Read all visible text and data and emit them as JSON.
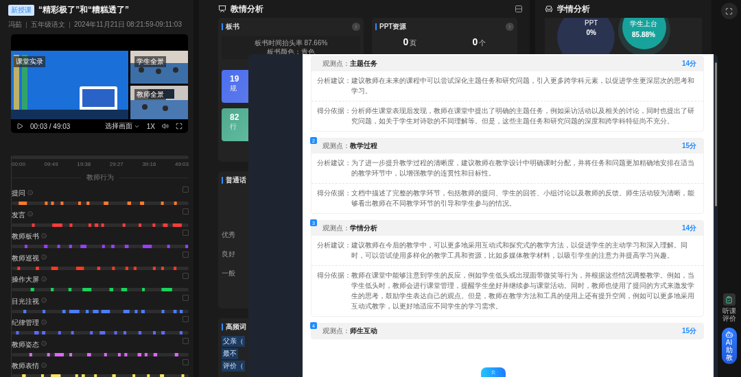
{
  "lesson": {
    "badge": "新授课",
    "title": "“精彩极了”和“糟糕透了”",
    "meta": [
      "冯茹",
      "五年级语文",
      "2024年11月21日 08:21:59-09:11:03"
    ]
  },
  "video": {
    "views": [
      "课堂实录",
      "学生全景",
      "教师全景"
    ],
    "time": "00:03 / 49:03",
    "view_select": "选择画面",
    "speed": "1X"
  },
  "timeline": {
    "ticks": [
      "00:00",
      "09:49",
      "19:38",
      "29:27",
      "39:16",
      "49:03"
    ],
    "section_title": "教师行为"
  },
  "behaviors": [
    {
      "label": "提问",
      "color": "#ff7a2e",
      "checked": false
    },
    {
      "label": "发言",
      "color": "#ff3b3b",
      "checked": false
    },
    {
      "label": "教师板书",
      "color": "#9b3cff",
      "checked": false
    },
    {
      "label": "教师巡视",
      "color": "#ff3a1f",
      "checked": false
    },
    {
      "label": "操作大屏",
      "color": "#19d35a",
      "checked": false
    },
    {
      "label": "目光注视",
      "color": "#4d7cff",
      "checked": false
    },
    {
      "label": "纪律管理",
      "color": "#5b6cff",
      "checked": false
    },
    {
      "label": "教师姿态",
      "color": "#e066ff",
      "checked": false
    },
    {
      "label": "教师表情",
      "color": "#f5e16a",
      "checked": false
    }
  ],
  "teaching": {
    "title": "教情分析",
    "board": {
      "title": "板书",
      "lines": [
        "板书时间抬头率 87.66%",
        "板书颜色：青色"
      ],
      "tiles": [
        {
          "value": "19",
          "label": "规"
        },
        {
          "value": "82",
          "label": "行"
        }
      ]
    },
    "ppt": {
      "title": "PPT资源",
      "stats": [
        {
          "value": "0",
          "unit": "页"
        },
        {
          "value": "0",
          "unit": "个"
        }
      ]
    },
    "mandarin": {
      "title": "普通话",
      "levels": [
        "优秀",
        "良好",
        "一般"
      ]
    },
    "words": {
      "title": "高频词",
      "items": [
        "父亲（",
        "最不",
        "评价（"
      ]
    }
  },
  "learning": {
    "title": "学情分析",
    "stats": [
      {
        "label": "PPT",
        "value": "0%"
      },
      {
        "label": "学生上台",
        "value": "85.88%"
      }
    ]
  },
  "side": {
    "evaluate": "听课评价",
    "ai": "AI助教"
  },
  "report": {
    "sections": [
      {
        "prefix": "观测点：",
        "title": "主题任务",
        "score": "14分",
        "advice_label": "分析建议：",
        "advice": "建议教师在未来的课程中可以尝试深化主题任务和研究问题，引入更多跨学科元素，以促进学生更深层次的思考和学习。",
        "basis_label": "得分依据：",
        "basis": "分析师生课堂表现后发现，教师在课堂中提出了明确的主题任务，例如采访活动以及相关的讨论，同时也提出了研究问题，如关于学生对诗歌的不同理解等。但是，这些主题任务和研究问题的深度和跨学科特征尚不充分。"
      },
      {
        "number": "2",
        "prefix": "观测点：",
        "title": "教学过程",
        "score": "15分",
        "advice_label": "分析建议：",
        "advice": "为了进一步提升教学过程的清晰度，建议教师在教学设计中明确课时分配，并将任务和问题更加精确地安排在适当的教学环节中，以增强教学的连贯性和目标性。",
        "basis_label": "得分依据：",
        "basis": "文档中描述了完整的教学环节，包括教师的提问、学生的回答、小组讨论以及教师的反馈。师生活动较为清晰，能够看出教师在不同教学环节的引导和学生参与的情况。"
      },
      {
        "number": "3",
        "prefix": "观测点：",
        "title": "学情分析",
        "score": "14分",
        "advice_label": "分析建议：",
        "advice": "建议教师在今后的教学中，可以更多地采用互动式和探究式的教学方法，以促进学生的主动学习和深入理解。同时，可以尝试使用多样化的教学工具和资源，比如多媒体教学材料，以吸引学生的注意力并提高学习兴趣。",
        "basis_label": "得分依据：",
        "basis": "教师在课堂中能够注意到学生的反应，例如学生低头或出现面带微笑等行为，并根据这些情况调整教学。例如，当学生低头时，教师会进行课堂管理，提醒学生坐好并继续参与课堂活动。同时，教师也使用了提问的方式来激发学生的思考，鼓励学生表达自己的观点。但是，教师在教学方法和工具的使用上还有提升空间，例如可以更多地采用互动式教学，以更好地适应不同学生的学习需求。"
      },
      {
        "number": "4",
        "prefix": "观测点：",
        "title": "师生互动",
        "score": "15分"
      }
    ]
  }
}
